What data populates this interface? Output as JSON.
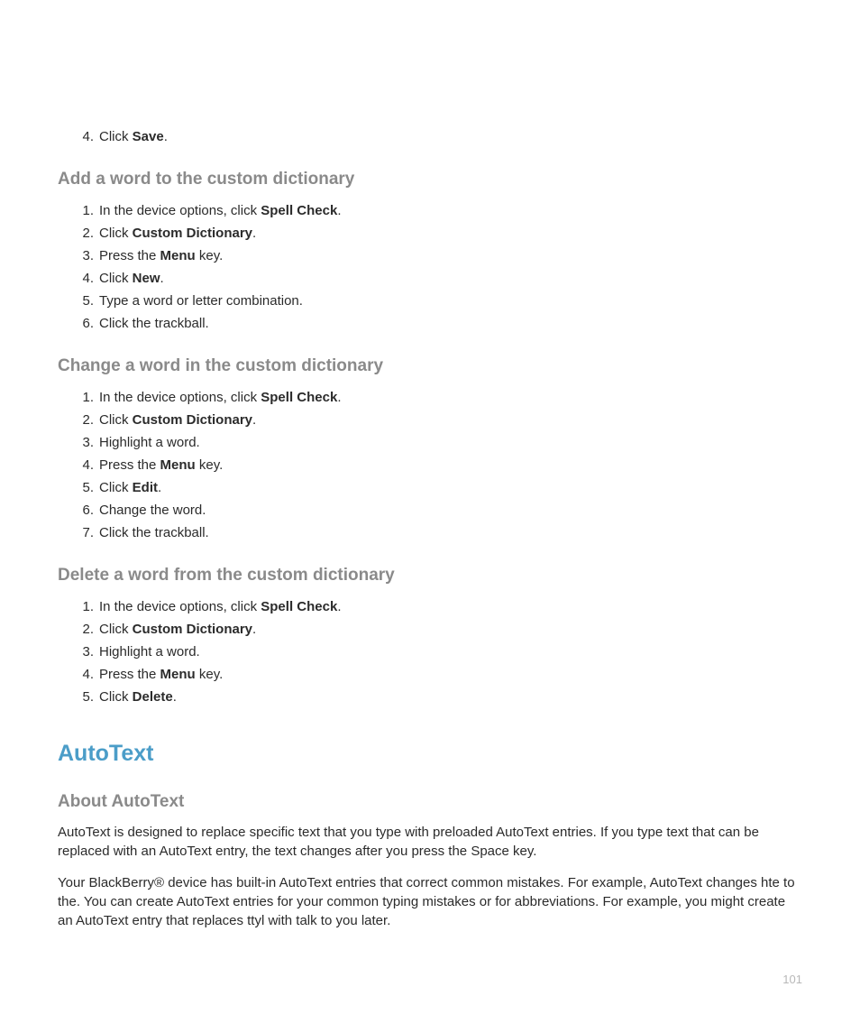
{
  "topList": {
    "items": [
      {
        "num": "4.",
        "prefix": "Click ",
        "bold": "Save",
        "suffix": "."
      }
    ]
  },
  "section1": {
    "heading": "Add a word to the custom dictionary",
    "items": [
      {
        "num": "1.",
        "prefix": "In the device options, click ",
        "bold": "Spell Check",
        "suffix": "."
      },
      {
        "num": "2.",
        "prefix": "Click ",
        "bold": "Custom Dictionary",
        "suffix": "."
      },
      {
        "num": "3.",
        "prefix": "Press the ",
        "bold": "Menu",
        "suffix": " key."
      },
      {
        "num": "4.",
        "prefix": "Click ",
        "bold": "New",
        "suffix": "."
      },
      {
        "num": "5.",
        "prefix": "Type a word or letter combination.",
        "bold": "",
        "suffix": ""
      },
      {
        "num": "6.",
        "prefix": "Click the trackball.",
        "bold": "",
        "suffix": ""
      }
    ]
  },
  "section2": {
    "heading": "Change a word in the custom dictionary",
    "items": [
      {
        "num": "1.",
        "prefix": "In the device options, click ",
        "bold": "Spell Check",
        "suffix": "."
      },
      {
        "num": "2.",
        "prefix": "Click ",
        "bold": "Custom Dictionary",
        "suffix": "."
      },
      {
        "num": "3.",
        "prefix": "Highlight a word.",
        "bold": "",
        "suffix": ""
      },
      {
        "num": "4.",
        "prefix": "Press the ",
        "bold": "Menu",
        "suffix": " key."
      },
      {
        "num": "5.",
        "prefix": "Click ",
        "bold": "Edit",
        "suffix": "."
      },
      {
        "num": "6.",
        "prefix": "Change the word.",
        "bold": "",
        "suffix": ""
      },
      {
        "num": "7.",
        "prefix": "Click the trackball.",
        "bold": "",
        "suffix": ""
      }
    ]
  },
  "section3": {
    "heading": "Delete a word from the custom dictionary",
    "items": [
      {
        "num": "1.",
        "prefix": "In the device options, click ",
        "bold": "Spell Check",
        "suffix": "."
      },
      {
        "num": "2.",
        "prefix": "Click ",
        "bold": "Custom Dictionary",
        "suffix": "."
      },
      {
        "num": "3.",
        "prefix": "Highlight a word.",
        "bold": "",
        "suffix": ""
      },
      {
        "num": "4.",
        "prefix": "Press the ",
        "bold": "Menu",
        "suffix": " key."
      },
      {
        "num": "5.",
        "prefix": "Click ",
        "bold": "Delete",
        "suffix": "."
      }
    ]
  },
  "autotext": {
    "title": "AutoText",
    "subheading": "About AutoText",
    "para1": "AutoText is designed to replace specific text that you type with preloaded AutoText entries. If you type text that can be replaced with an AutoText entry, the text changes after you press the Space key.",
    "para2": "Your BlackBerry® device has built-in AutoText entries that correct common mistakes. For example, AutoText changes hte to the. You can create AutoText entries for your common typing mistakes or for abbreviations. For example, you might create an AutoText entry that replaces ttyl with talk to you later."
  },
  "pageNumber": "101"
}
